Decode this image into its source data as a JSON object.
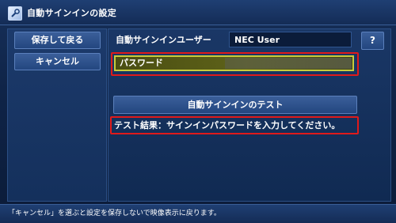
{
  "window": {
    "title": "自動サインインの設定",
    "icon": "wrench-settings-icon"
  },
  "sidebar": {
    "save_label": "保存して戻る",
    "cancel_label": "キャンセル"
  },
  "form": {
    "user_label": "自動サインインユーザー",
    "user_value": "NEC User",
    "help_label": "?",
    "password_label": "パスワード",
    "password_value": "",
    "test_button_label": "自動サインインのテスト",
    "test_result": "テスト結果：サインインパスワードを入力してください。"
  },
  "status": {
    "hint": "「キャンセル」を選ぶと設定を保存しないで映像表示に戻ります。"
  },
  "colors": {
    "highlight_outline": "#e01a1a",
    "focus_border": "#c8cc3d",
    "button_bg": "#23467f",
    "panel_bg": "#14305c"
  }
}
